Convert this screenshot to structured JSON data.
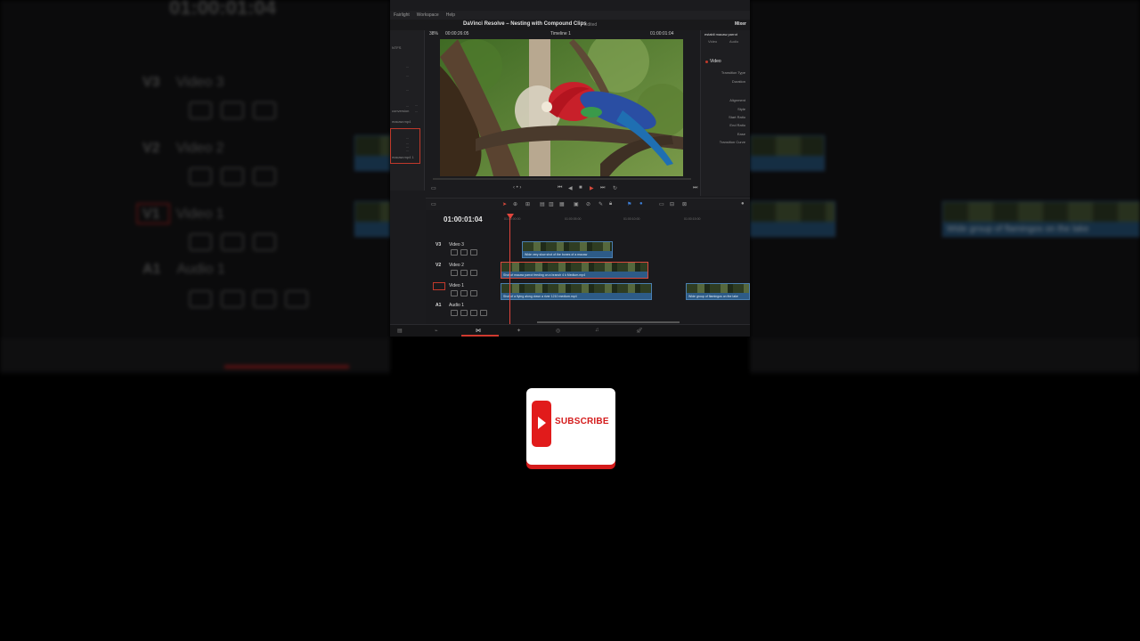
{
  "background_left": {
    "timecode": "01:00:01:04",
    "tracks": [
      {
        "id": "V3",
        "name": "Video 3"
      },
      {
        "id": "V2",
        "name": "Video 2"
      },
      {
        "id": "V1",
        "name": "Video 1"
      },
      {
        "id": "A1",
        "name": "Audio 1"
      }
    ]
  },
  "background_right": {
    "clip_label": "Wide group of flamingos on the lake"
  },
  "menubar": {
    "items": [
      "Fairlight",
      "Workspace",
      "Help"
    ]
  },
  "titlebar": {
    "title": "DaVinci Resolve – Nesting with Compound Clips",
    "status": "Edited",
    "mixer_label": "Mixer"
  },
  "viewer": {
    "zoom": "38%",
    "source_timecode": "00:00:26:05",
    "timeline_name": "Timeline 1",
    "record_timecode": "01:00:01:04"
  },
  "media_pool": {
    "items": [
      "NTFS",
      "...",
      "...",
      "...",
      "...",
      "conversion",
      "...",
      "...",
      "macaw.mp4",
      "...",
      "...",
      "...",
      "...",
      "macaw.mp4 1"
    ]
  },
  "inspector": {
    "clip_name": "establi macaw parrot",
    "tabs": [
      "Video",
      "Audio"
    ],
    "section": "Video",
    "rows": [
      "Transition Type",
      "Duration",
      "Alignment",
      "Style",
      "Start Ratio",
      "End Ratio",
      "Ease",
      "Transition Curve"
    ]
  },
  "timeline": {
    "timecode": "01:00:01:04",
    "ruler": [
      "01:00:00:00",
      "01:00:05:00",
      "01:00:10:00",
      "01:00:15:00"
    ],
    "tracks": [
      {
        "id": "V3",
        "name": "Video 3"
      },
      {
        "id": "V2",
        "name": "Video 2"
      },
      {
        "id": "V1",
        "name": "Video 1"
      },
      {
        "id": "A1",
        "name": "Audio 1"
      }
    ],
    "clips": {
      "v3": "Wide very slow shot of the bones of a macaw",
      "v2": "Shot of macaw parrot feeding on a branch 4 k Medium.mp4",
      "v1a": "Shot of a flying along down a river 1210 medium.mp4",
      "v1b": "Wide group of flamingos on the lake"
    }
  },
  "subscribe": {
    "label": "SUBSCRIBE"
  },
  "colors": {
    "accent_red": "#e11b1b",
    "clip_blue": "#2d5b87",
    "playhead": "#e0453c"
  }
}
